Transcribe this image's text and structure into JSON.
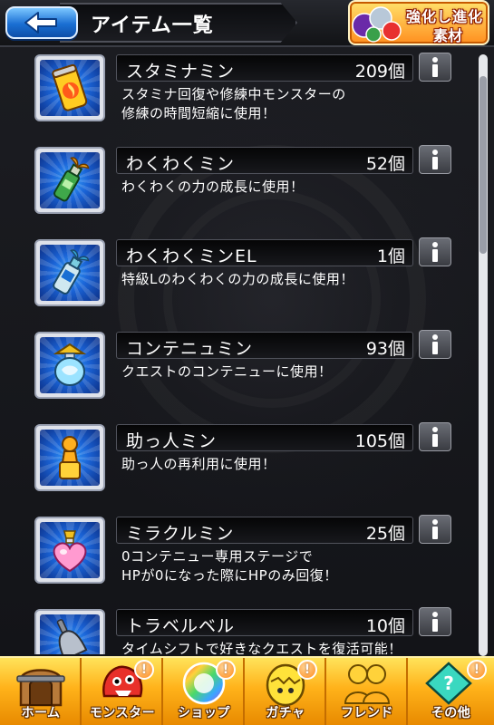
{
  "header": {
    "title": "アイテム一覧",
    "evolution_button": {
      "line1": "強化し進化",
      "line2": "素材"
    }
  },
  "items": [
    {
      "name": "スタミナミン",
      "count": "209個",
      "description": "スタミナ回復や修練中モンスターの\n修練の時間短縮に使用！",
      "icon": "stamina-can-icon"
    },
    {
      "name": "わくわくミン",
      "count": "52個",
      "description": "わくわくの力の成長に使用！",
      "icon": "wakuwaku-bottle-icon"
    },
    {
      "name": "わくわくミンEL",
      "count": "1個",
      "description": "特級Lのわくわくの力の成長に使用！",
      "icon": "wakuwaku-el-bottle-icon"
    },
    {
      "name": "コンテニュミン",
      "count": "93個",
      "description": "クエストのコンテニューに使用！",
      "icon": "continue-potion-icon"
    },
    {
      "name": "助っ人ミン",
      "count": "105個",
      "description": "助っ人の再利用に使用！",
      "icon": "helper-figure-icon"
    },
    {
      "name": "ミラクルミン",
      "count": "25個",
      "description": "0コンテニュー専用ステージで\nHPが0になった際にHPのみ回復！",
      "icon": "miracle-heart-bottle-icon"
    },
    {
      "name": "トラベルベル",
      "count": "10個",
      "description": "タイムシフトで好きなクエストを復活可能！",
      "icon": "travel-bell-icon"
    }
  ],
  "nav": [
    {
      "label": "ホーム",
      "icon": "home-gate-icon",
      "alert": false
    },
    {
      "label": "モンスター",
      "icon": "monster-icon",
      "alert": true
    },
    {
      "label": "ショップ",
      "icon": "rainbow-orb-icon",
      "alert": true
    },
    {
      "label": "ガチャ",
      "icon": "gacha-egg-icon",
      "alert": true
    },
    {
      "label": "フレンド",
      "icon": "friends-icon",
      "alert": false
    },
    {
      "label": "その他",
      "icon": "other-icon",
      "alert": true
    }
  ],
  "alert_mark": "!",
  "colors": {
    "accent_blue": "#1a6fd3",
    "nav_orange": "#ffb21a",
    "icon_bg_blue": "#1a63d6"
  }
}
